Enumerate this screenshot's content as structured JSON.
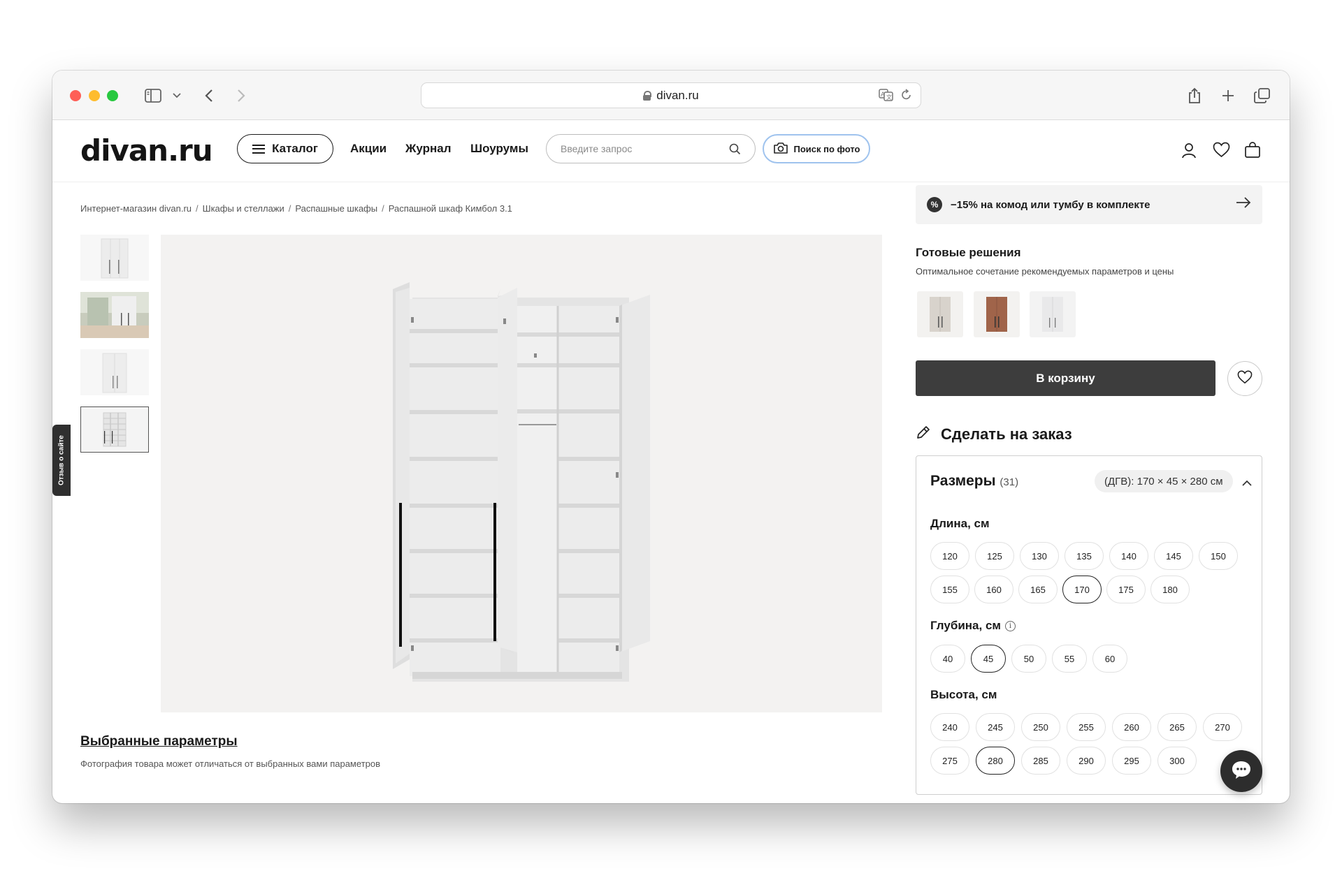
{
  "browser": {
    "url": "divan.ru"
  },
  "header": {
    "logo": "divan.ru",
    "catalog_label": "Каталог",
    "nav": [
      "Акции",
      "Журнал",
      "Шоурумы"
    ],
    "search_placeholder": "Введите запрос",
    "photo_search_label": "Поиск по фото"
  },
  "breadcrumbs": [
    "Интернет-магазин divan.ru",
    "Шкафы и стеллажи",
    "Распашные шкафы",
    "Распашной шкаф Кимбол 3.1"
  ],
  "gallery": {
    "selected_params_label": "Выбранные параметры",
    "photo_note": "Фотография товара может отличаться от выбранных вами параметров"
  },
  "feedback_tab": "Отзыв о сайте",
  "promo": {
    "badge": "%",
    "text": "−15% на комод или тумбу в комплекте"
  },
  "ready_solutions": {
    "title": "Готовые решения",
    "subtitle": "Оптимальное сочетание рекомендуемых параметров и цены",
    "variant_colors": [
      "#d8d3cc",
      "#a0644a",
      "#e9e9ea"
    ]
  },
  "cart_label": "В корзину",
  "custom_order_label": "Сделать на заказ",
  "sizes": {
    "title": "Размеры",
    "count": "(31)",
    "summary": "(ДГВ): 170 × 45 × 280 см",
    "length": {
      "label": "Длина, см",
      "row1": [
        "120",
        "125",
        "130",
        "135",
        "140",
        "145",
        "150"
      ],
      "row2": [
        "155",
        "160",
        "165",
        "170",
        "175",
        "180"
      ],
      "selected": "170"
    },
    "depth": {
      "label": "Глубина, см",
      "info": "i",
      "row1": [
        "40",
        "45",
        "50",
        "55",
        "60"
      ],
      "selected": "45"
    },
    "height": {
      "label": "Высота, см",
      "row1": [
        "240",
        "245",
        "250",
        "255",
        "260",
        "265",
        "270"
      ],
      "row2": [
        "275",
        "280",
        "285",
        "290",
        "295",
        "300"
      ],
      "selected": "280"
    }
  }
}
